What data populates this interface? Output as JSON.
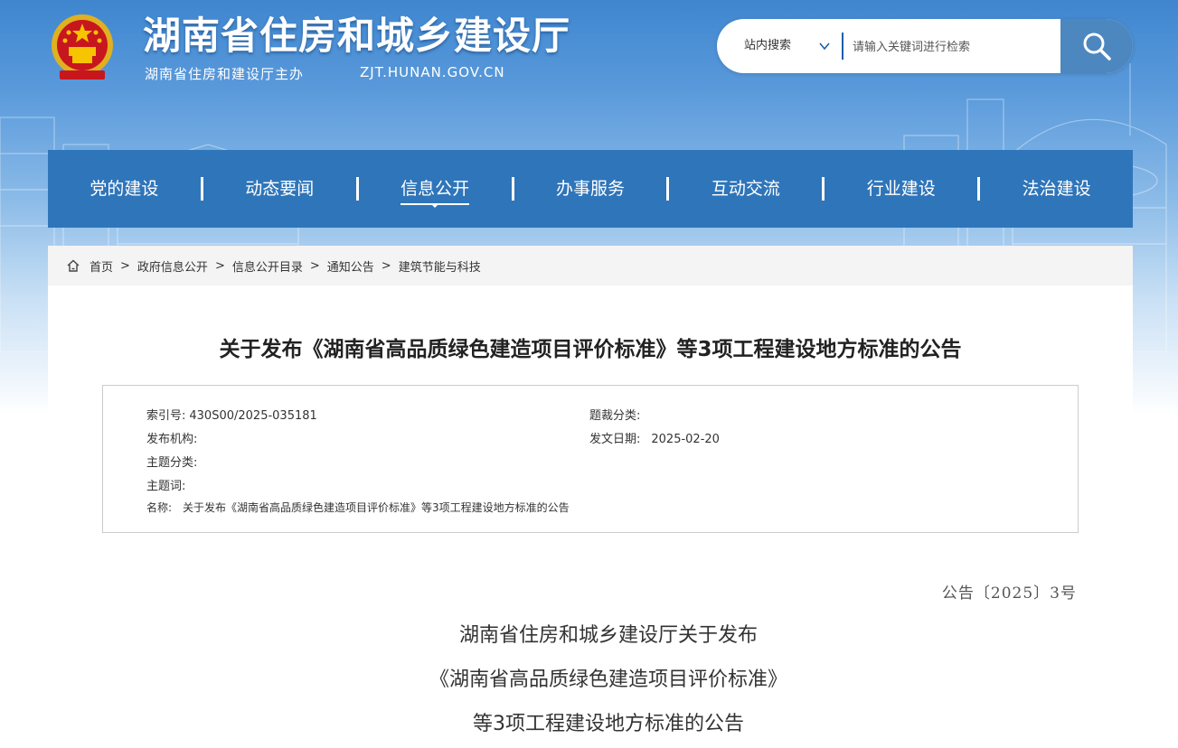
{
  "header": {
    "title": "湖南省住房和城乡建设厅",
    "subtitle": "湖南省住房和建设厅主办",
    "domain": "ZJT.HUNAN.GOV.CN",
    "emblem_icon": "national-emblem-icon"
  },
  "search": {
    "scope_label": "站内搜索",
    "placeholder": "请输入关键词进行检索",
    "button_icon": "search-icon"
  },
  "nav": {
    "items": [
      "党的建设",
      "动态要闻",
      "信息公开",
      "办事服务",
      "互动交流",
      "行业建设",
      "法治建设"
    ],
    "active": "信息公开"
  },
  "breadcrumb": {
    "home_icon": "home-icon",
    "items": [
      "首页",
      "政府信息公开",
      "信息公开目录",
      "通知公告",
      "建筑节能与科技"
    ],
    "separator": ">"
  },
  "article": {
    "title": "关于发布《湖南省高品质绿色建造项目评价标准》等3项工程建设地方标准的公告",
    "meta": {
      "index_label": "索引号:",
      "index_value": "430S00/2025-035181",
      "category_label": "题裁分类:",
      "category_value": "",
      "publisher_label": "发布机构:",
      "publisher_value": "",
      "date_label": "发文日期:",
      "date_value": "2025-02-20",
      "topic_label": "主题分类:",
      "topic_value": "",
      "keywords_label": "主题词:",
      "keywords_value": "",
      "name_label": "名称:",
      "name_value": "关于发布《湖南省高品质绿色建造项目评价标准》等3项工程建设地方标准的公告"
    },
    "doc_number": "公告〔2025〕3号",
    "body_lines": [
      "湖南省住房和城乡建设厅关于发布",
      "《湖南省高品质绿色建造项目评价标准》",
      "等3项工程建设地方标准的公告"
    ]
  },
  "colors": {
    "nav_bg": "#2f75ba",
    "search_button": "#4d87c0",
    "header_top": "#3f86cf"
  }
}
